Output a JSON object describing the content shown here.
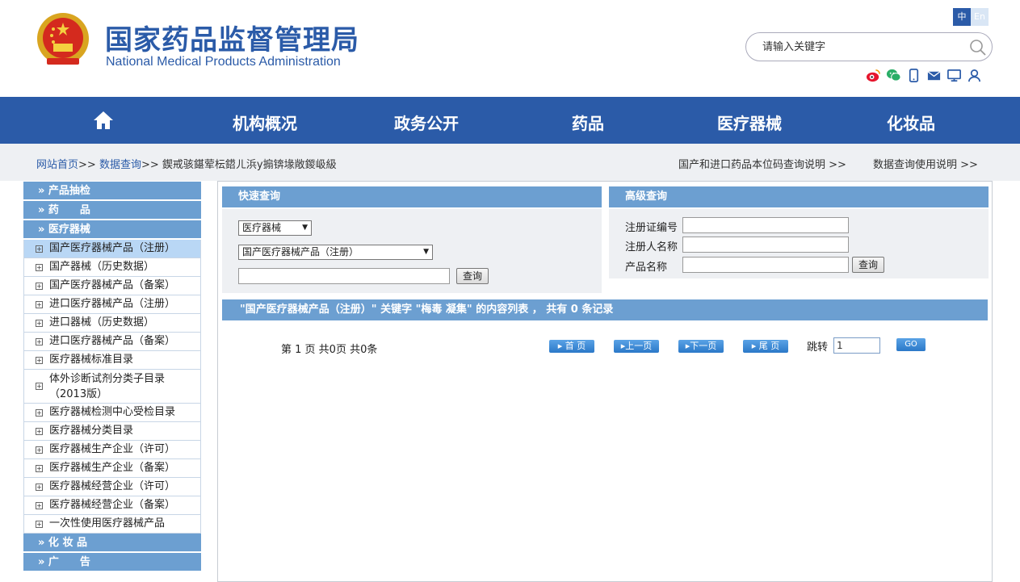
{
  "header": {
    "title_cn": "国家药品监督管理局",
    "title_en": "National Medical Products Administration",
    "lang_zh": "中",
    "lang_en": "En",
    "search_placeholder": "请输入关键字"
  },
  "nav": {
    "items": [
      "机构概况",
      "政务公开",
      "药品",
      "医疗器械",
      "化妆品"
    ]
  },
  "breadcrumb": {
    "home": "网站首页",
    "sep": ">>",
    "data_query": "数据查询",
    "current": "鍥戒骇鍖荤枟鍣ㄦ浜у搧锛堟敞鍐岋級",
    "right_link1": "国产和进口药品本位码查询说明 >>",
    "right_link2": "数据查询使用说明 >>"
  },
  "sidebar": {
    "cat1": "» 产品抽检",
    "cat2": "» 药　　品",
    "cat3": "» 医疗器械",
    "items": [
      "国产医疗器械产品（注册）",
      "国产器械（历史数据）",
      "国产医疗器械产品（备案）",
      "进口医疗器械产品（注册）",
      "进口器械（历史数据）",
      "进口医疗器械产品（备案）",
      "医疗器械标准目录",
      "体外诊断试剂分类子目录（2013版）",
      "医疗器械检测中心受检目录",
      "医疗器械分类目录",
      "医疗器械生产企业（许可）",
      "医疗器械生产企业（备案）",
      "医疗器械经营企业（许可）",
      "医疗器械经营企业（备案）",
      "一次性使用医疗器械产品"
    ],
    "cat4": "» 化 妆 品",
    "cat5": "» 广　　告"
  },
  "quick": {
    "title": "快速查询",
    "select1": "医疗器械",
    "select2": "国产医疗器械产品（注册）",
    "button": "查询"
  },
  "advanced": {
    "title": "高级查询",
    "label1": "注册证编号",
    "label2": "注册人名称",
    "label3": "产品名称",
    "button": "查询"
  },
  "results": {
    "header": "\"国产医疗器械产品（注册）\" 关键字 \"梅毒 凝集\" 的内容列表 ， 共有 0 条记录",
    "page_info": "第 1 页 共0页 共0条",
    "first": "首 页",
    "prev": "上一页",
    "next": "下一页",
    "last": "尾 页",
    "jump_label": "跳转",
    "jump_value": "1",
    "go": "GO"
  },
  "colors": {
    "brand_blue": "#2b5ba8",
    "panel_blue": "#6c9fd1"
  }
}
